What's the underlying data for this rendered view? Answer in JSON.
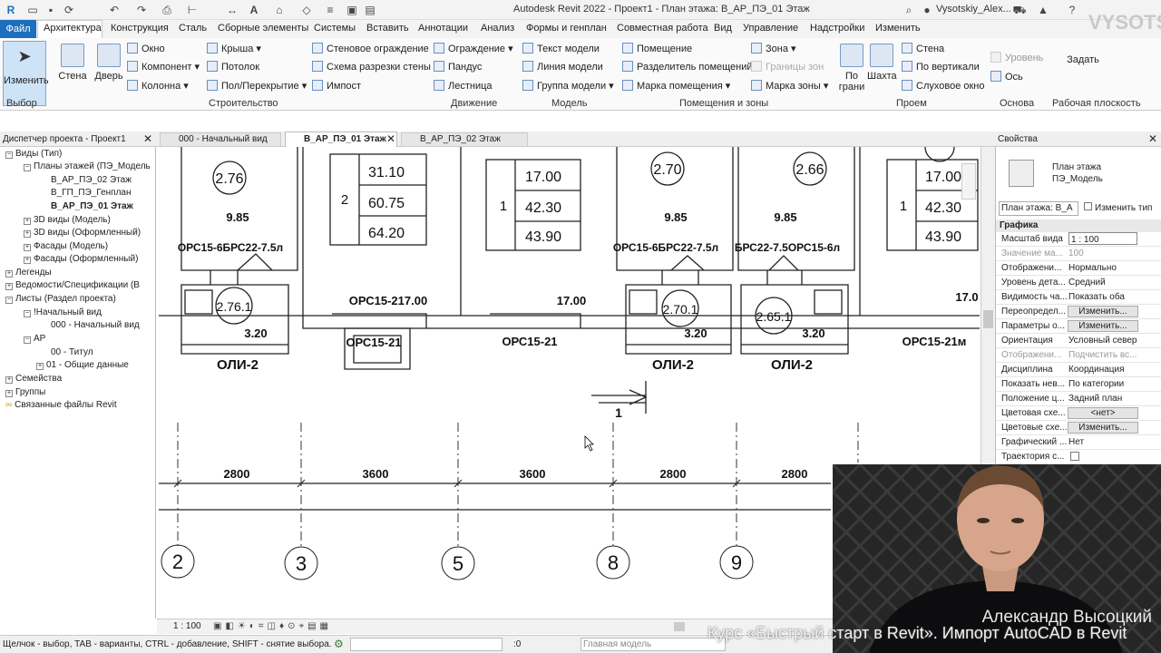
{
  "app": {
    "title": "Autodesk Revit 2022 - Проект1 - План этажа: В_АР_ПЭ_01 Этаж",
    "user": "Vysotskiy_Alex...",
    "watermark": "VYSOTSKIY"
  },
  "ribbon_tabs": [
    "Файл",
    "Архитектура",
    "Конструкция",
    "Сталь",
    "Сборные элементы",
    "Системы",
    "Вставить",
    "Аннотации",
    "Анализ",
    "Формы и генплан",
    "Совместная работа",
    "Вид",
    "Управление",
    "Надстройки",
    "Изменить"
  ],
  "ribbon": {
    "modify": "Изменить",
    "wall": "Стена",
    "door": "Дверь",
    "window": "Окно",
    "component": "Компонент",
    "column": "Колонна",
    "roof": "Крыша",
    "ceiling": "Потолок",
    "floor": "Пол/Перекрытие",
    "curtain_wall": "Стеновое ограждение",
    "curtain_grid": "Схема разрезки стены",
    "mullion": "Импост",
    "railing": "Ограждение",
    "ramp": "Пандус",
    "stair": "Лестница",
    "model_text": "Текст модели",
    "model_line": "Линия модели",
    "model_group": "Группа модели",
    "room": "Помещение",
    "room_separator": "Разделитель помещений",
    "room_tag": "Марка помещения",
    "area": "Зона",
    "area_boundary": "Границы зон",
    "area_tag": "Марка зоны",
    "by_face": "По грани",
    "shaft": "Шахта",
    "opening_wall": "Стена",
    "vertical": "По вертикали",
    "dormer": "Слуховое окно",
    "level": "Уровень",
    "grid": "Ось",
    "set": "Задать",
    "group_select": "Выбор",
    "group_build": "Строительство",
    "group_circulation": "Движение",
    "group_model": "Модель",
    "group_room": "Помещения и зоны",
    "group_opening": "Проем",
    "group_datum": "Основа",
    "group_workplane": "Рабочая плоскость"
  },
  "view_tabs": [
    "000 - Начальный вид",
    "В_АР_ПЭ_01 Этаж",
    "В_АР_ПЭ_02 Этаж"
  ],
  "browser": {
    "title": "Диспетчер проекта - Проект1",
    "items": [
      "Виды (Тип)",
      "Планы этажей (ПЭ_Модель",
      "В_АР_ПЭ_02 Этаж",
      "В_ГП_ПЭ_Генплан",
      "В_АР_ПЭ_01 Этаж",
      "3D виды (Модель)",
      "3D виды (Оформленный)",
      "Фасады (Модель)",
      "Фасады (Оформленный)",
      "Легенды",
      "Ведомости/Спецификации (В",
      "Листы (Раздел проекта)",
      "!Начальный вид",
      "000 - Начальный вид",
      "АР",
      "00 - Титул",
      "01 - Общие данные",
      "Семейства",
      "Группы",
      "Связанные файлы Revit"
    ]
  },
  "properties": {
    "title": "Свойства",
    "type_line1": "План этажа",
    "type_line2": "ПЭ_Модель",
    "selector": "План этажа: В_А",
    "edit_type": "Изменить тип",
    "section": "Графика",
    "rows": [
      {
        "k": "Масштаб вида",
        "v": "1 : 100"
      },
      {
        "k": "Значение ма...",
        "v": "100"
      },
      {
        "k": "Отображени...",
        "v": "Нормально"
      },
      {
        "k": "Уровень дета...",
        "v": "Средний"
      },
      {
        "k": "Видимость ча...",
        "v": "Показать оба"
      },
      {
        "k": "Переопредел...",
        "v": "Изменить..."
      },
      {
        "k": "Параметры о...",
        "v": "Изменить..."
      },
      {
        "k": "Ориентация",
        "v": "Условный север"
      },
      {
        "k": "Отображени...",
        "v": "Подчистить вс..."
      },
      {
        "k": "Дисциплина",
        "v": "Координация"
      },
      {
        "k": "Показать нев...",
        "v": "По категории"
      },
      {
        "k": "Положение ц...",
        "v": "Задний план"
      },
      {
        "k": "Цветовая схе...",
        "v": "<нет>"
      },
      {
        "k": "Цветовые схе...",
        "v": "Изменить..."
      },
      {
        "k": "Графический ...",
        "v": "Нет"
      },
      {
        "k": "Траектория с...",
        "v": ""
      }
    ]
  },
  "drawing": {
    "tags": [
      "2.76",
      "2.70",
      "2.66",
      "2.76.1",
      "2.70.1",
      "2.65.1"
    ],
    "areas": [
      "9.85",
      "9.85",
      "9.85",
      "3.20",
      "3.20",
      "3.20"
    ],
    "table1_num": "2",
    "table1": [
      "31.10",
      "60.75",
      "64.20"
    ],
    "table2_num": "1",
    "table2": [
      "17.00",
      "42.30",
      "43.90"
    ],
    "table3_num": "1",
    "table3": [
      "17.00",
      "42.30",
      "43.90"
    ],
    "labels": [
      "ОРС15-6БРС22-7.5л",
      "ОРС15-6БРС22-7.5л",
      "БРС22-7.5ОРС15-6л",
      "ОРС15-217.00",
      "17.00",
      "17.0",
      "ОРС15-21",
      "ОРС15-21",
      "ОРС15-21м",
      "ОЛИ-2",
      "ОЛИ-2",
      "ОЛИ-2"
    ],
    "section_mark": "1",
    "dims": [
      "2800",
      "3600",
      "3600",
      "2800",
      "2800"
    ],
    "grids": [
      "2",
      "3",
      "5",
      "8",
      "9"
    ]
  },
  "viewbar": {
    "scale": "1 : 100"
  },
  "status": {
    "hint": "Щелчок - выбор, TAB - варианты, CTRL - добавление, SHIFT - снятие выбора.",
    "coord": ":0",
    "model": "Главная модель"
  },
  "webcam": {
    "name": "Александр Высоцкий",
    "course": "Курс «Быстрый старт в Revit». Импорт AutoCAD в Revit"
  }
}
